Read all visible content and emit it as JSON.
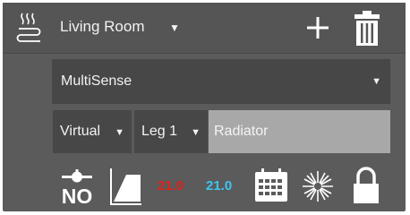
{
  "header": {
    "room": "Living Room",
    "icons": [
      "heater-icon",
      "chevron-down-icon",
      "plus-icon",
      "trash-icon"
    ]
  },
  "device": {
    "selected": "MultiSense"
  },
  "config": {
    "mode": "Virtual",
    "leg": "Leg 1",
    "name_value": "Radiator"
  },
  "status": {
    "valve_label": "NO",
    "setpoint": "21.0",
    "current_temp": "21.0",
    "setpoint_color": "#e0201a",
    "current_color": "#3ec5f0",
    "icons": [
      "valve-no-icon",
      "curve-icon",
      "calendar-icon",
      "sun-icon",
      "lock-icon"
    ]
  },
  "colors": {
    "panel": "#5b5b5b",
    "header": "#555555",
    "select_bg": "#474747",
    "input_bg": "#a8a8a8",
    "icon": "#ffffff"
  }
}
